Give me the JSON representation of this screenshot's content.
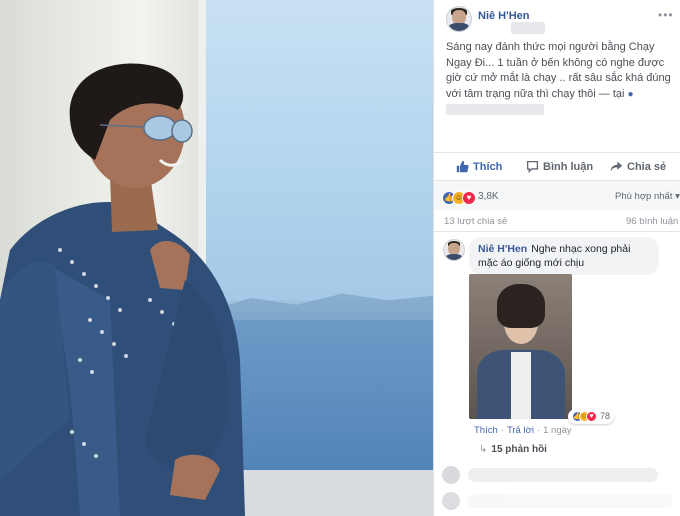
{
  "post": {
    "author": "Niê H'Hen",
    "caption": "Sáng nay đánh thức mọi người bằng Chạy Ngay Đi... 1 tuần ở bến không có nghe được giờ cứ mở mắt là chạy .. rất sâu sắc khá đúng với tâm trạng nữa thì chạy thôi —",
    "location_prefix": "tại",
    "more_icon": "•••"
  },
  "actions": {
    "like": "Thích",
    "comment": "Bình luận",
    "share": "Chia sẻ"
  },
  "stats": {
    "reaction_count": "3,8K",
    "sort_label": "Phù hợp nhất ▾",
    "shares": "13 lượt chia sẻ",
    "comments": "96 bình luận"
  },
  "comment": {
    "author": "Niê H'Hen",
    "text": "Nghe nhạc xong phải mặc áo giống mới chịu",
    "reaction_count": "78",
    "like_link": "Thích",
    "reply_link": "Trả lời",
    "time": "1 ngày",
    "separator": "·",
    "replies": "15 phản hồi",
    "replies_arrow": "↳"
  }
}
